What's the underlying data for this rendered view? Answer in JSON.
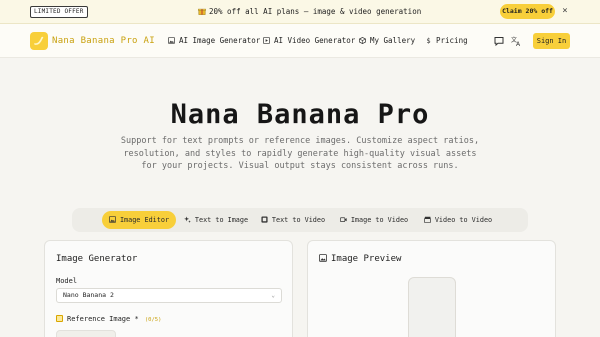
{
  "banner": {
    "tag": "LIMITED OFFER",
    "promo": "20% off all AI plans — image & video generation",
    "claim_label": "Claim 20% off",
    "close_glyph": "×"
  },
  "nav": {
    "brand": "Nana Banana Pro AI",
    "links": [
      {
        "label": "AI Image Generator",
        "icon": "image-icon"
      },
      {
        "label": "AI Video Generator",
        "icon": "video-icon"
      },
      {
        "label": "My Gallery",
        "icon": "gallery-icon"
      },
      {
        "label": "Pricing",
        "icon": "dollar-icon"
      }
    ],
    "signin_label": "Sign In"
  },
  "hero": {
    "title": "Nana Banana Pro",
    "subtitle": "Support for text prompts or reference images. Customize aspect ratios, resolution, and styles to rapidly generate high-quality visual assets for your projects. Visual output stays consistent across runs."
  },
  "modes": [
    {
      "label": "Image Editor",
      "icon": "image-icon",
      "active": true
    },
    {
      "label": "Text to Image",
      "icon": "sparkle-icon",
      "active": false
    },
    {
      "label": "Text to Video",
      "icon": "film-icon",
      "active": false
    },
    {
      "label": "Image to Video",
      "icon": "camera-icon",
      "active": false
    },
    {
      "label": "Video to Video",
      "icon": "clapper-icon",
      "active": false
    }
  ],
  "generator": {
    "title": "Image Generator",
    "model_label": "Model",
    "model_value": "Nano Banana 2",
    "reference_label": "Reference Image",
    "reference_required": "*",
    "reference_count": "(0/5)"
  },
  "preview": {
    "title": "Image Preview"
  },
  "colors": {
    "accent": "#f8cf3a",
    "brand_text": "#c9a10f",
    "background": "#f6f5f1"
  }
}
